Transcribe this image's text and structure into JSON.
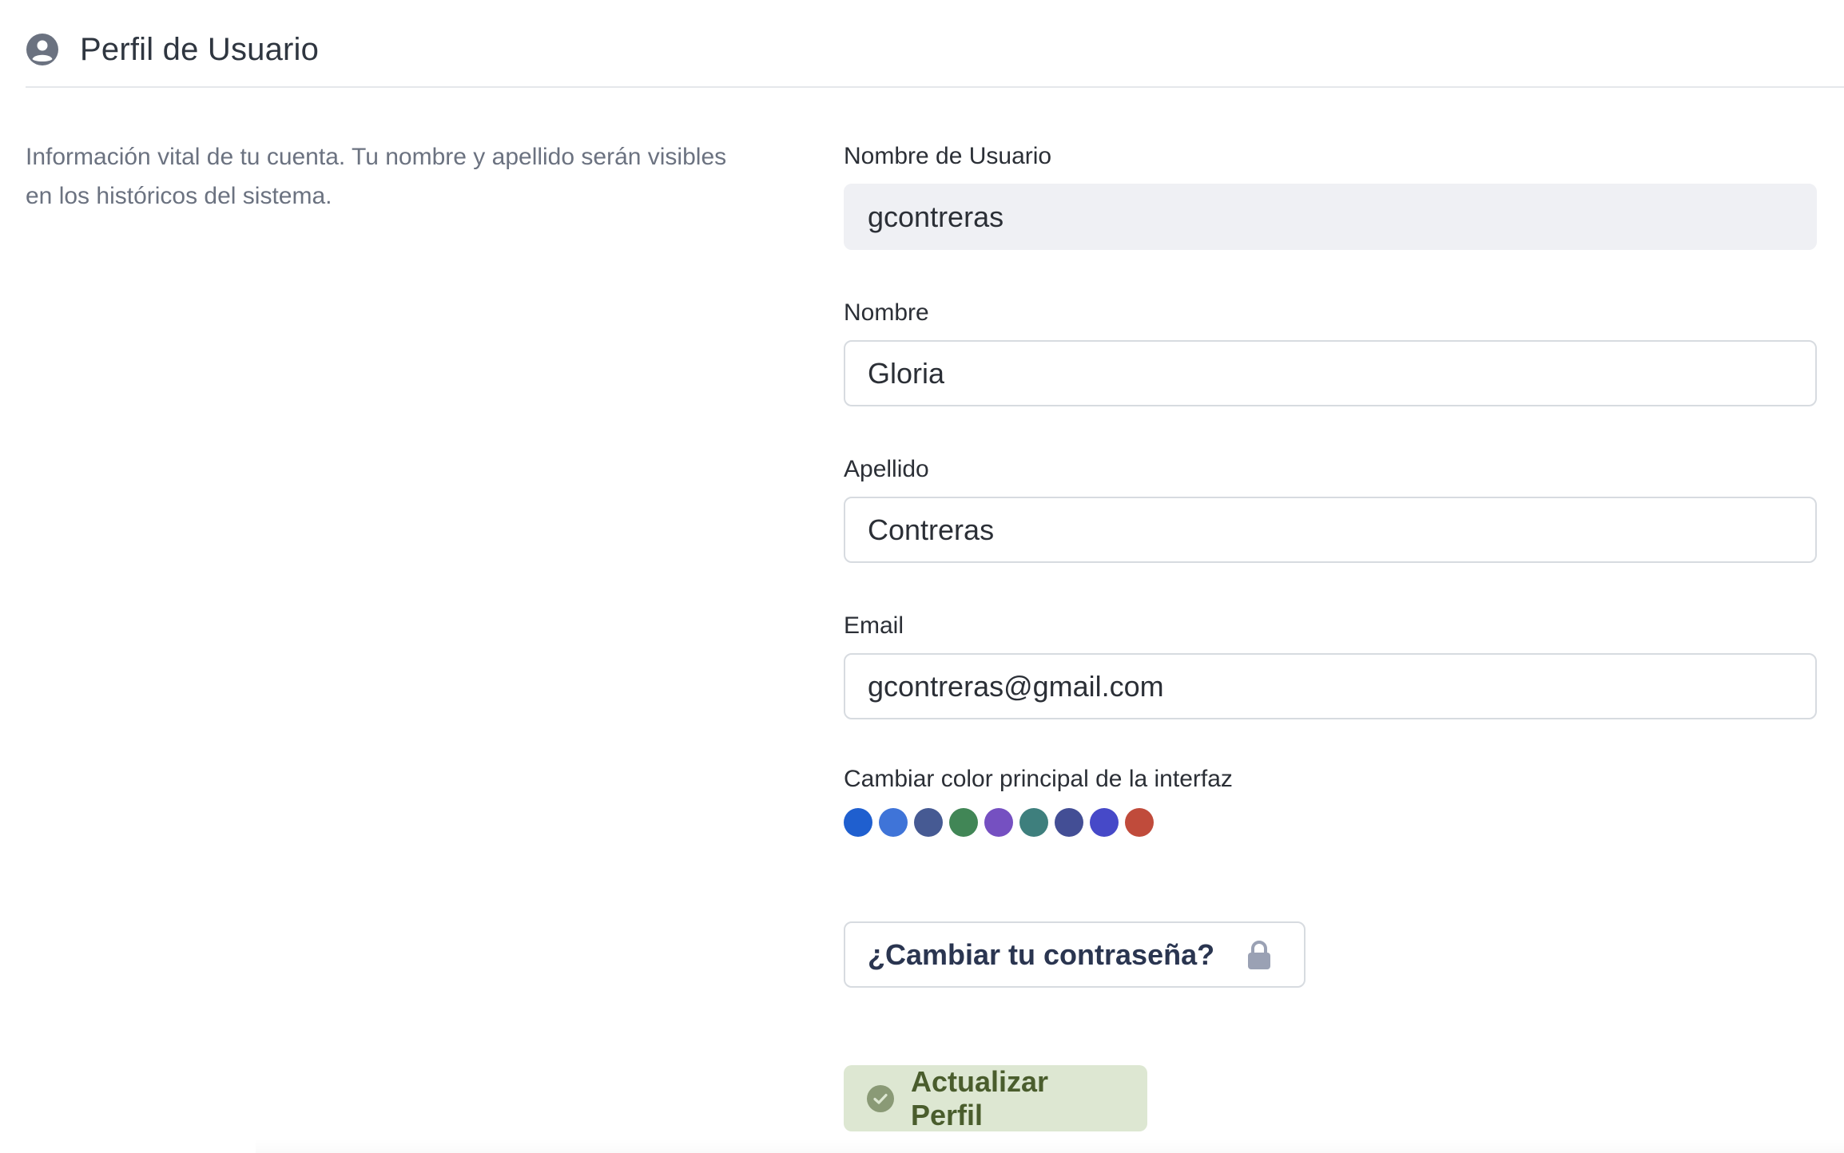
{
  "header": {
    "title": "Perfil de Usuario",
    "icon": "user-circle-icon"
  },
  "description": "Información vital de tu cuenta. Tu nombre y apellido serán visibles en los históricos del sistema.",
  "fields": {
    "username": {
      "label": "Nombre de Usuario",
      "value": "gcontreras"
    },
    "first_name": {
      "label": "Nombre",
      "value": "Gloria"
    },
    "last_name": {
      "label": "Apellido",
      "value": "Contreras"
    },
    "email": {
      "label": "Email",
      "value": "gcontreras@gmail.com"
    }
  },
  "color_picker": {
    "label": "Cambiar color principal de la interfaz",
    "colors": [
      "#1f5fcf",
      "#3f74d8",
      "#465a93",
      "#418656",
      "#7550c1",
      "#3e7f7d",
      "#434e95",
      "#4649c8",
      "#c04b3b"
    ]
  },
  "change_password": {
    "label": "¿Cambiar tu contraseña?",
    "icon": "lock-icon"
  },
  "update_button": {
    "label": "Actualizar Perfil",
    "icon": "check-circle-icon"
  },
  "theme": {
    "update_button_bg": "#dde7d2",
    "update_button_text": "#4a5d2d",
    "readonly_input_bg": "#eff0f4"
  }
}
